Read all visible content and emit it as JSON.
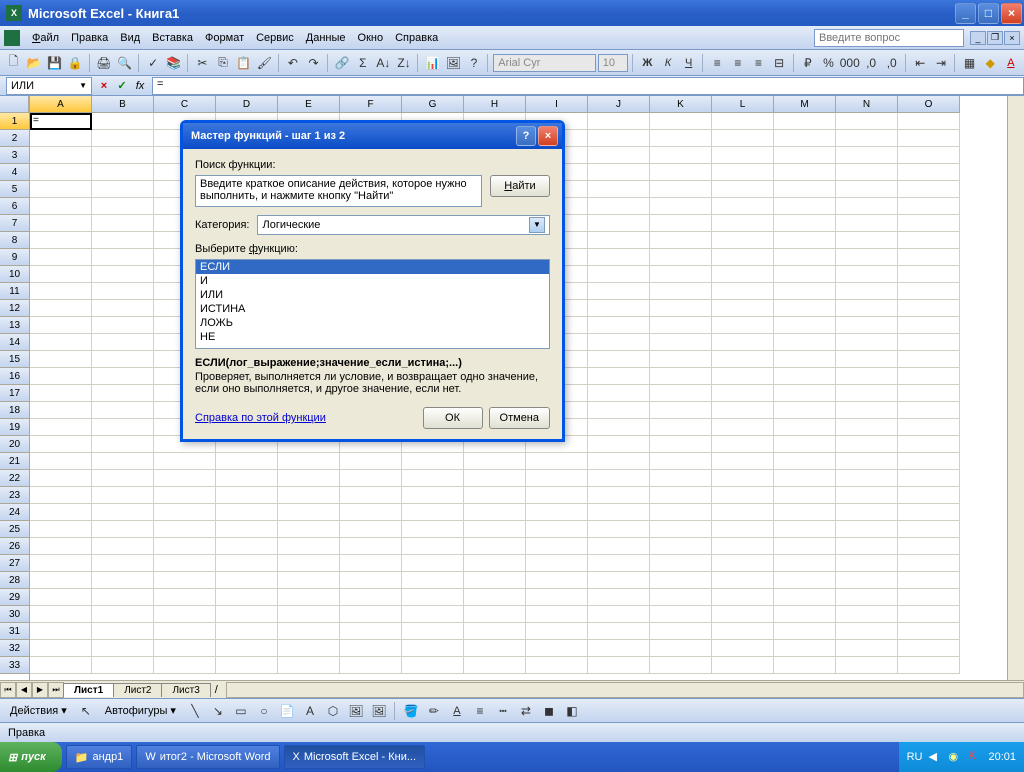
{
  "titlebar": {
    "title": "Microsoft Excel - Книга1"
  },
  "menu": {
    "items": [
      "Файл",
      "Правка",
      "Вид",
      "Вставка",
      "Формат",
      "Сервис",
      "Данные",
      "Окно",
      "Справка"
    ],
    "ask_placeholder": "Введите вопрос"
  },
  "toolbar": {
    "font_name": "Arial Cyr",
    "font_size": "10"
  },
  "formulabar": {
    "namebox": "ИЛИ",
    "fx": "fx",
    "formula": "="
  },
  "grid": {
    "columns": [
      "A",
      "B",
      "C",
      "D",
      "E",
      "F",
      "G",
      "H",
      "I",
      "J",
      "K",
      "L",
      "M",
      "N",
      "O"
    ],
    "rows": 33,
    "active_cell_value": "="
  },
  "sheets": {
    "tabs": [
      "Лист1",
      "Лист2",
      "Лист3"
    ],
    "active": 0
  },
  "drawbar": {
    "actions": "Действия",
    "autoshapes": "Автофигуры"
  },
  "statusbar": {
    "mode": "Правка"
  },
  "taskbar": {
    "start": "пуск",
    "items": [
      {
        "label": "андр1",
        "icon": "📁"
      },
      {
        "label": "итог2 - Microsoft Word",
        "icon": "W"
      },
      {
        "label": "Microsoft Excel - Кни...",
        "icon": "X"
      }
    ],
    "lang": "RU",
    "time": "20:01"
  },
  "dialog": {
    "title": "Мастер функций - шаг 1 из 2",
    "search_label": "Поиск функции:",
    "search_text": "Введите краткое описание действия, которое нужно выполнить, и нажмите кнопку \"Найти\"",
    "find_btn": "Найти",
    "category_label": "Категория:",
    "category_value": "Логические",
    "select_label": "Выберите функцию:",
    "functions": [
      "ЕСЛИ",
      "И",
      "ИЛИ",
      "ИСТИНА",
      "ЛОЖЬ",
      "НЕ"
    ],
    "selected_index": 0,
    "signature": "ЕСЛИ(лог_выражение;значение_если_истина;...)",
    "description": "Проверяет, выполняется ли условие, и возвращает одно значение, если оно выполняется, и другое значение, если нет.",
    "help_link": "Справка по этой функции",
    "ok": "ОК",
    "cancel": "Отмена"
  }
}
